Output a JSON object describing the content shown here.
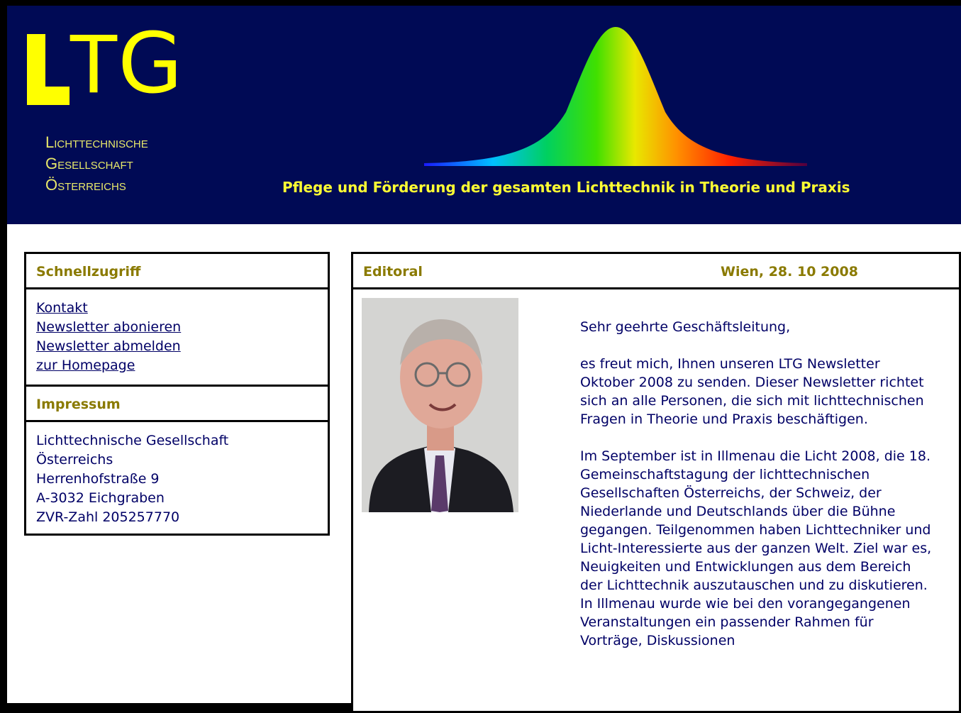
{
  "header": {
    "logo": "LTG",
    "org_lines": [
      "Lichttechnische",
      "Gesellschaft",
      "Österreichs"
    ],
    "tagline": "Pflege und Förderung der gesamten Lichttechnik in Theorie und Praxis"
  },
  "sidebar": {
    "quick_title": "Schnellzugriff",
    "links": [
      {
        "label": "Kontakt"
      },
      {
        "label": "Newsletter abonieren"
      },
      {
        "label": "Newsletter abmelden"
      },
      {
        "label": "zur Homepage"
      }
    ],
    "impressum_title": "Impressum",
    "address_lines": [
      "Lichttechnische Gesellschaft",
      "Österreichs",
      "Herrenhofstraße 9",
      "A-3032 Eichgraben",
      "ZVR-Zahl 205257770"
    ]
  },
  "main": {
    "title": "Editoral",
    "date": "Wien, 28. 10 2008",
    "paragraphs": [
      "Sehr geehrte Geschäftsleitung,",
      "es freut mich, Ihnen unseren LTG Newsletter Oktober 2008 zu senden. Dieser Newsletter richtet sich an alle Personen, die sich mit lichttechnischen Fragen in Theorie und Praxis beschäftigen.",
      "Im September ist in Illmenau die Licht 2008, die 18. Gemeinschaftstagung der lichttechnischen Gesellschaften Österreichs, der Schweiz, der Niederlande und Deutschlands über die Bühne gegangen. Teilgenommen haben Lichttechniker und Licht-Interessierte aus der ganzen Welt. Ziel war es, Neuigkeiten und Entwicklungen aus dem Bereich der Lichttechnik auszutauschen und zu diskutieren. In Illmenau wurde wie bei den vorangegangenen Veranstaltungen ein passender Rahmen für Vorträge, Diskussionen"
    ]
  },
  "colors": {
    "banner": "#000a55",
    "logo": "#ffff00",
    "heading": "#8a7a00",
    "text": "#000066"
  }
}
